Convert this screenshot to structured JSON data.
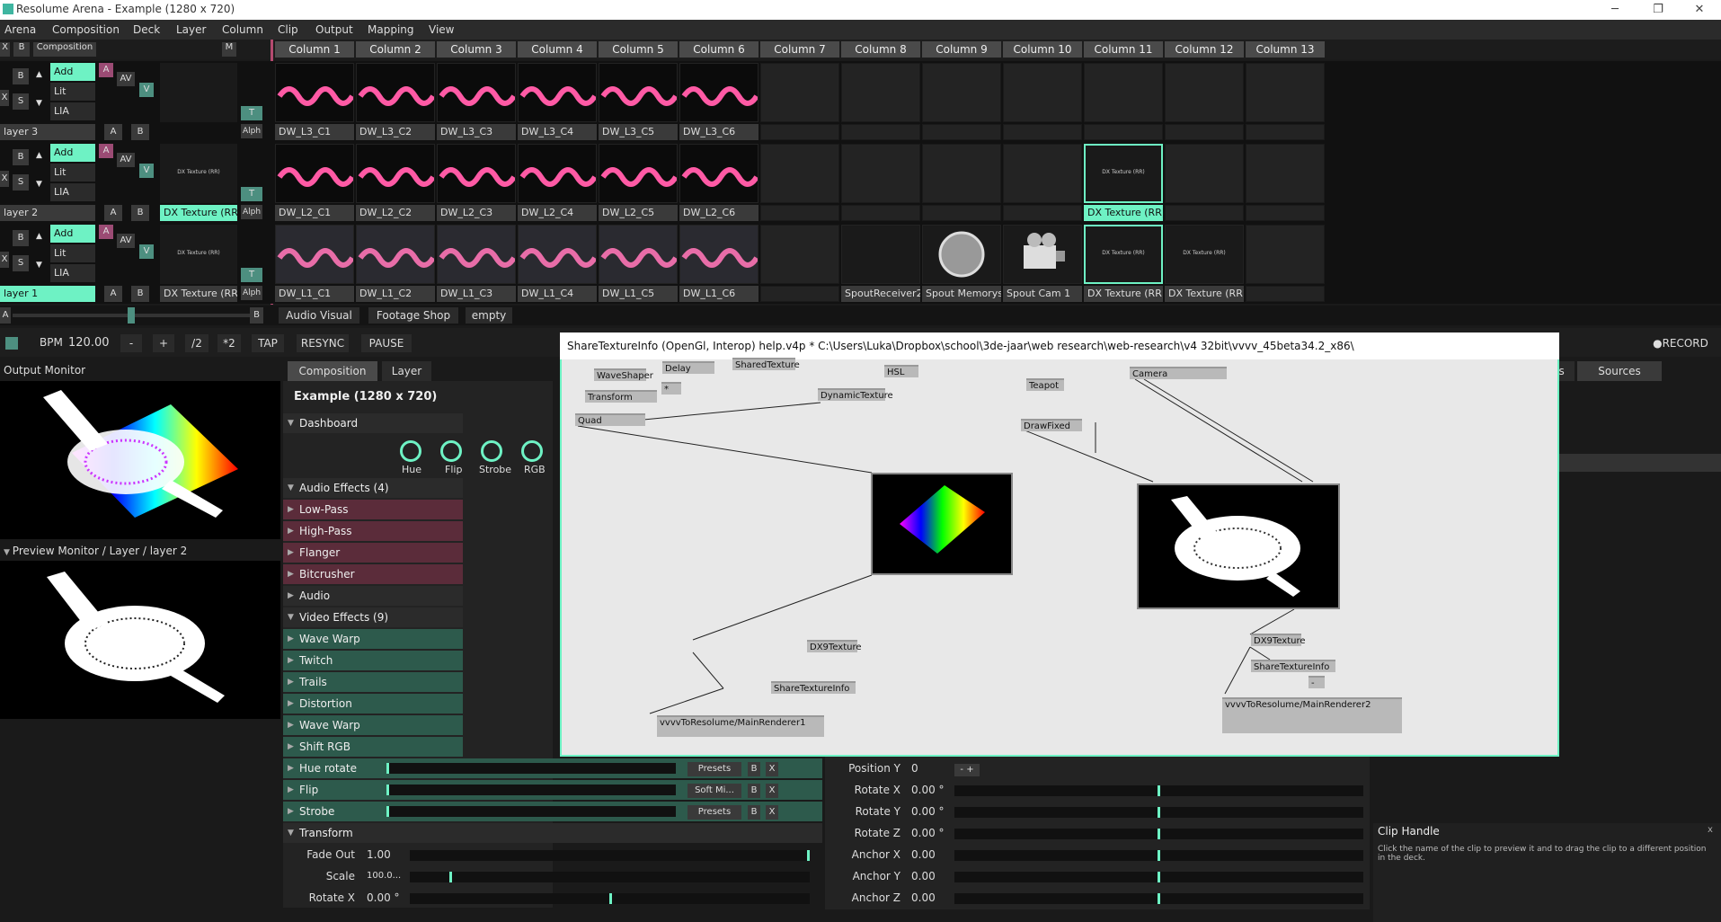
{
  "window": {
    "title": "Resolume Arena - Example (1280 x 720)",
    "minimize": "─",
    "restore": "❐",
    "close": "✕"
  },
  "menu": [
    "Arena",
    "Composition",
    "Deck",
    "Layer",
    "Column",
    "Clip",
    "Output",
    "Mapping",
    "View"
  ],
  "deck_header": {
    "x": "X",
    "b": "B",
    "composition": "Composition",
    "m": "M"
  },
  "columns": [
    "Column 1",
    "Column 2",
    "Column 3",
    "Column 4",
    "Column 5",
    "Column 6",
    "Column 7",
    "Column 8",
    "Column 9",
    "Column 10",
    "Column 11",
    "Column 12",
    "Column 13"
  ],
  "layers": [
    {
      "name": "layer 3",
      "blend": "Add",
      "opts": [
        "Lit",
        "LIA"
      ],
      "clips": [
        "DW_L3_C1",
        "DW_L3_C2",
        "DW_L3_C3",
        "DW_L3_C4",
        "DW_L3_C5",
        "DW_L3_C6",
        "",
        "",
        "",
        "",
        "",
        "",
        ""
      ],
      "preview": ""
    },
    {
      "name": "layer 2",
      "blend": "Add",
      "opts": [
        "Lit",
        "LIA"
      ],
      "clips": [
        "DW_L2_C1",
        "DW_L2_C2",
        "DW_L2_C3",
        "DW_L2_C4",
        "DW_L2_C5",
        "DW_L2_C6",
        "",
        "",
        "",
        "",
        "DX Texture (RR)",
        "",
        ""
      ],
      "preview": "DX Texture (RR)"
    },
    {
      "name": "layer 1",
      "blend": "Add",
      "opts": [
        "Lit",
        "LIA"
      ],
      "clips": [
        "DW_L1_C1",
        "DW_L1_C2",
        "DW_L1_C3",
        "DW_L1_C4",
        "DW_L1_C5",
        "DW_L1_C6",
        "",
        "SpoutReceiver2",
        "Spout Memorysh...",
        "Spout Cam 1",
        "DX Texture (RR)",
        "DX Texture (RR)",
        ""
      ],
      "preview": "DX Texture (RR)"
    }
  ],
  "layer_ctrl": {
    "x": "X",
    "b": "B",
    "s": "S",
    "a": "A",
    "av": "AV",
    "v": "V",
    "t": "T",
    "alph": "Alph",
    "ab_a": "A",
    "ab_b": "B",
    "up": "▲",
    "down": "▼"
  },
  "thumb_label": "DX Texture (RR)",
  "decks": [
    "Audio Visual",
    "Footage Shop",
    "empty"
  ],
  "deckrow": {
    "a": "A",
    "b": "B"
  },
  "transport": {
    "bpm_label": "BPM",
    "bpm": "120.00",
    "minus": "-",
    "plus": "+",
    "half": "/2",
    "double": "*2",
    "tap": "TAP",
    "resync": "RESYNC",
    "pause": "PAUSE",
    "record": "●RECORD"
  },
  "monitors": {
    "output": "Output Monitor",
    "preview": "Preview Monitor / Layer / layer 2"
  },
  "tabs": {
    "composition": "Composition",
    "layer": "Layer",
    "effects": "cts",
    "sources": "Sources"
  },
  "comp": {
    "title": "Example (1280 x 720)",
    "dashboard": "Dashboard",
    "knobs": [
      "Hue",
      "Flip",
      "Strobe",
      "RGB"
    ]
  },
  "audio_effects": {
    "header": "Audio Effects (4)",
    "items": [
      "Low-Pass",
      "High-Pass",
      "Flanger",
      "Bitcrusher",
      "Audio"
    ]
  },
  "video_effects": {
    "header": "Video Effects (9)",
    "items": [
      "Wave Warp",
      "Twitch",
      "Trails",
      "Distortion",
      "Wave Warp",
      "Shift RGB",
      "Hue rotate",
      "Flip",
      "Strobe"
    ]
  },
  "fx_presets": {
    "hue": "Presets",
    "flip": "Soft Mi...",
    "strobe": "Presets",
    "b": "B",
    "x": "X"
  },
  "transform": {
    "header": "Transform",
    "params": [
      {
        "label": "Fade Out",
        "value": "1.00"
      },
      {
        "label": "Scale",
        "value": "100.0..."
      },
      {
        "label": "Rotate X",
        "value": "0.00 °"
      }
    ]
  },
  "right_params": [
    {
      "label": "Position Y",
      "value": "0"
    },
    {
      "label": "Rotate X",
      "value": "0.00 °"
    },
    {
      "label": "Rotate Y",
      "value": "0.00 °"
    },
    {
      "label": "Rotate Z",
      "value": "0.00 °"
    },
    {
      "label": "Anchor X",
      "value": "0.00"
    },
    {
      "label": "Anchor Y",
      "value": "0.00"
    },
    {
      "label": "Anchor Z",
      "value": "0.00"
    }
  ],
  "pos_btns": "- +",
  "clip_handle": {
    "title": "Clip Handle",
    "text": "Click the name of the clip to preview it and to drag the clip to a different position in the deck.",
    "close": "x"
  },
  "vvvv": {
    "title": "ShareTextureInfo (OpenGl, Interop) help.v4p *  C:\\Users\\Luka\\Dropbox\\school\\3de-jaar\\web research\\web-research\\v4 32bit\\vvvv_45beta34.2_x86\\",
    "nodes": {
      "waveshaper": "WaveShaper",
      "delay": "Delay",
      "sharedtex": "SharedTexture",
      "star": "*",
      "transform": "Transform",
      "dyntex": "DynamicTexture",
      "hsl": "HSL",
      "quad": "Quad",
      "teapot": "Teapot",
      "camera": "Camera",
      "drawfixed": "DrawFixed",
      "dx9a": "DX9Texture",
      "sti1": "ShareTextureInfo",
      "mr1": "vvvvToResolume/MainRenderer1",
      "dx9b": "DX9Texture",
      "sti2": "ShareTextureInfo",
      "mr2": "vvvvToResolume/MainRenderer2",
      "minus": "-"
    }
  }
}
